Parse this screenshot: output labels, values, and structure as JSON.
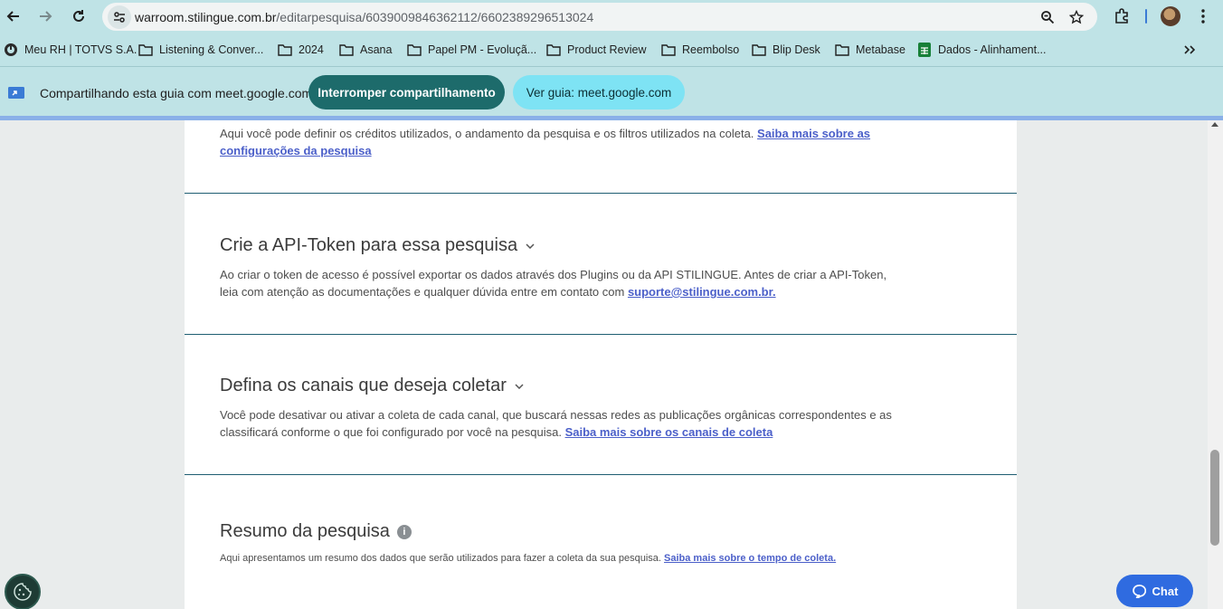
{
  "browser": {
    "url_host": "warroom.stilingue.com.br",
    "url_path": "/editarpesquisa/6039009846362112/6602389296513024"
  },
  "bookmarks": [
    {
      "label": "Meu RH | TOTVS S.A.",
      "icon": "totvs-icon"
    },
    {
      "label": "Listening & Conver...",
      "icon": "folder-icon"
    },
    {
      "label": "2024",
      "icon": "folder-icon"
    },
    {
      "label": "Asana",
      "icon": "folder-icon"
    },
    {
      "label": "Papel PM - Evoluçã...",
      "icon": "folder-icon"
    },
    {
      "label": "Product Review",
      "icon": "folder-icon"
    },
    {
      "label": "Reembolso",
      "icon": "folder-icon"
    },
    {
      "label": "Blip Desk",
      "icon": "folder-icon"
    },
    {
      "label": "Metabase",
      "icon": "folder-icon"
    },
    {
      "label": "Dados - Alinhament...",
      "icon": "sheets-icon"
    }
  ],
  "sharing": {
    "text": "Compartilhando esta guia com meet.google.com",
    "stop_label": "Interromper compartilhamento",
    "view_label": "Ver guia: meet.google.com"
  },
  "page": {
    "intro": {
      "text": "Aqui você pode definir os créditos utilizados, o andamento da pesquisa e os filtros utilizados na coleta. ",
      "link": "Saiba mais sobre as configurações da pesquisa"
    },
    "api_token": {
      "title": "Crie a API-Token para essa pesquisa",
      "text": "Ao criar o token de acesso é possível exportar os dados através dos Plugins ou da API STILINGUE. Antes de criar a API-Token, leia com atenção as documentações e qualquer dúvida entre em contato com ",
      "link": "suporte@stilingue.com.br."
    },
    "channels": {
      "title": "Defina os canais que deseja coletar",
      "text": "Você pode desativar ou ativar a coleta de cada canal, que buscará nessas redes as publicações orgânicas correspondentes e as classificará conforme o que foi configurado por você na pesquisa. ",
      "link": "Saiba mais sobre os canais de coleta"
    },
    "summary": {
      "title": "Resumo da pesquisa",
      "text": "Aqui apresentamos um resumo dos dados que serão utilizados para fazer a coleta da sua pesquisa. ",
      "link": "Saiba mais sobre o tempo de coleta."
    }
  },
  "widgets": {
    "chat_label": "Chat"
  }
}
